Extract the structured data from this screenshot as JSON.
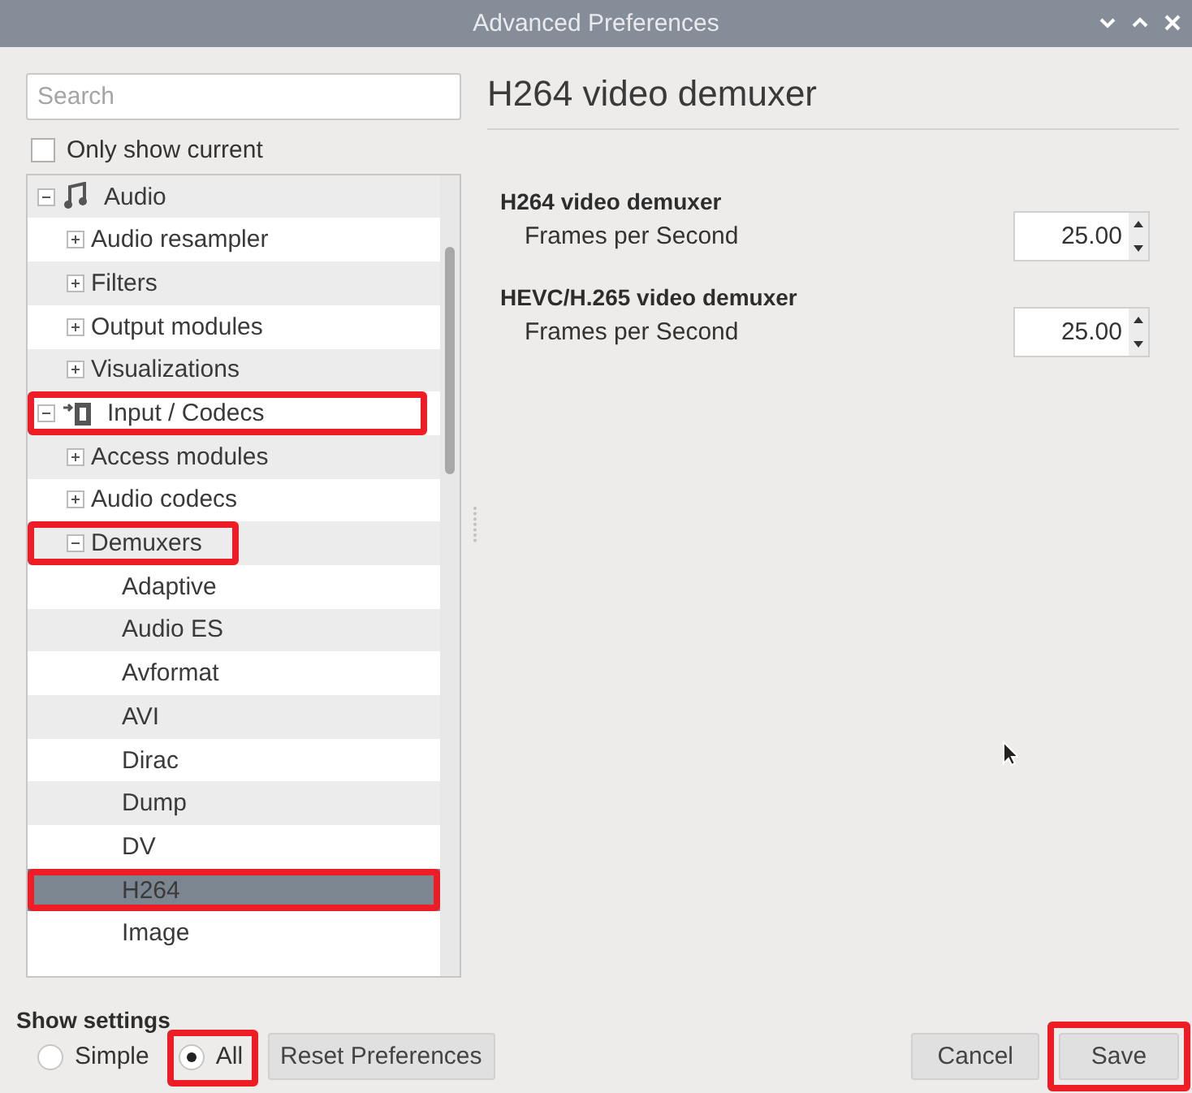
{
  "window": {
    "title": "Advanced Preferences"
  },
  "search": {
    "placeholder": "Search"
  },
  "only_show_current": {
    "label": "Only show current",
    "checked": false
  },
  "tree": [
    {
      "label": "Audio",
      "expanded": true,
      "selected": false,
      "highlighted": false,
      "children": [
        {
          "label": "Audio resampler",
          "expanded": false,
          "selected": false,
          "highlighted": false
        },
        {
          "label": "Filters",
          "expanded": false,
          "selected": false,
          "highlighted": false
        },
        {
          "label": "Output modules",
          "expanded": false,
          "selected": false,
          "highlighted": false
        },
        {
          "label": "Visualizations",
          "expanded": false,
          "selected": false,
          "highlighted": false
        }
      ]
    },
    {
      "label": "Input / Codecs",
      "expanded": true,
      "selected": false,
      "highlighted": true,
      "children": [
        {
          "label": "Access modules",
          "expanded": false,
          "selected": false,
          "highlighted": false
        },
        {
          "label": "Audio codecs",
          "expanded": false,
          "selected": false,
          "highlighted": false
        },
        {
          "label": "Demuxers",
          "expanded": true,
          "selected": false,
          "highlighted": true,
          "children": [
            {
              "label": "Adaptive",
              "selected": false,
              "highlighted": false
            },
            {
              "label": "Audio ES",
              "selected": false,
              "highlighted": false
            },
            {
              "label": "Avformat",
              "selected": false,
              "highlighted": false
            },
            {
              "label": "AVI",
              "selected": false,
              "highlighted": false
            },
            {
              "label": "Dirac",
              "selected": false,
              "highlighted": false
            },
            {
              "label": "Dump",
              "selected": false,
              "highlighted": false
            },
            {
              "label": "DV",
              "selected": false,
              "highlighted": false
            },
            {
              "label": "H264",
              "selected": true,
              "highlighted": true
            },
            {
              "label": "Image",
              "selected": false,
              "highlighted": false
            }
          ]
        }
      ]
    }
  ],
  "panel": {
    "title": "H264 video demuxer",
    "sections": [
      {
        "heading": "H264 video demuxer",
        "label": "Frames per Second",
        "value": "25.00"
      },
      {
        "heading": "HEVC/H.265 video demuxer",
        "label": "Frames per Second",
        "value": "25.00"
      }
    ]
  },
  "show_settings": {
    "label": "Show settings",
    "options": [
      {
        "label": "Simple",
        "selected": false,
        "highlighted": false
      },
      {
        "label": "All",
        "selected": true,
        "highlighted": true
      }
    ]
  },
  "buttons": [
    {
      "label": "Reset Preferences",
      "kind": "reset",
      "highlighted": false
    },
    {
      "label": "Cancel",
      "kind": "action",
      "highlighted": false
    },
    {
      "label": "Save",
      "kind": "action",
      "highlighted": true
    }
  ]
}
